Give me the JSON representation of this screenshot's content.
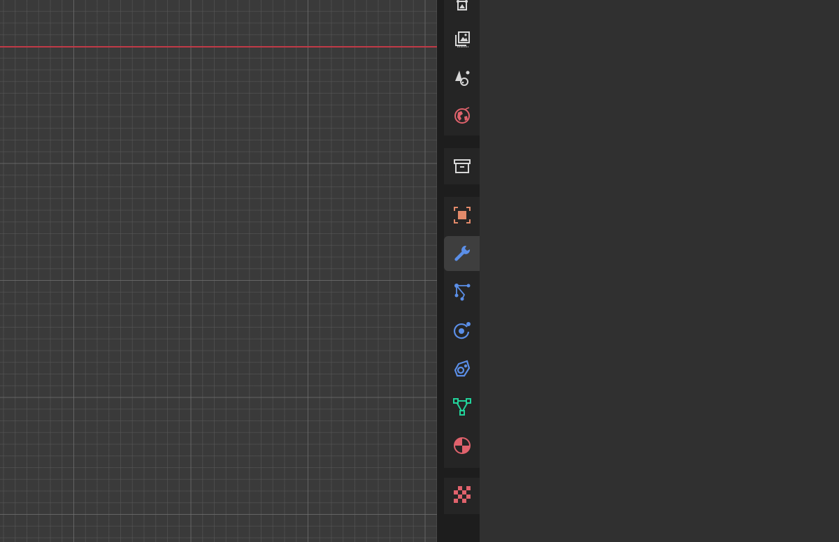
{
  "viewport": {
    "axis_color": "#c13a47"
  },
  "properties_tabs": [
    {
      "id": "render",
      "icon": "render-icon"
    },
    {
      "id": "output",
      "icon": "output-icon"
    },
    {
      "id": "view_layer",
      "icon": "view-layer-icon"
    },
    {
      "id": "scene",
      "icon": "scene-icon"
    },
    {
      "id": "world",
      "icon": "world-icon"
    },
    {
      "id": "collection",
      "icon": "collection-icon"
    },
    {
      "id": "object",
      "icon": "object-icon"
    },
    {
      "id": "modifiers",
      "icon": "wrench-icon",
      "active": true
    },
    {
      "id": "particles",
      "icon": "particles-icon"
    },
    {
      "id": "physics",
      "icon": "physics-icon"
    },
    {
      "id": "constraints",
      "icon": "object-constraints-icon"
    },
    {
      "id": "data",
      "icon": "mesh-data-icon"
    },
    {
      "id": "material",
      "icon": "material-icon"
    },
    {
      "id": "texture",
      "icon": "texture-icon"
    }
  ],
  "colors": {
    "white_icon": "#d8d8d8",
    "red_icon": "#e0626c",
    "orange_icon": "#e38a6a",
    "blue_icon": "#5b8fe8",
    "green_icon": "#22d39b"
  }
}
